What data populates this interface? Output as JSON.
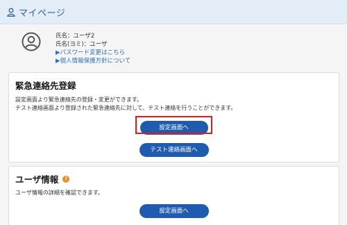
{
  "header": {
    "title": "マイページ",
    "icon": "user-icon"
  },
  "profile": {
    "avatar_icon": "user-circle-icon",
    "name": "氏名：ユーザ2",
    "name_kana": "氏名(ヨミ)：ユーザ",
    "password_link": "▶パスワード変更はこちら",
    "privacy_link": "▶個人情報保護方針について"
  },
  "emergency": {
    "title": "緊急連絡先登録",
    "desc1": "設定画面より緊急連絡先の登録・変更ができます。",
    "desc2": "テスト連絡画面より登録された緊急連絡先に対して、テスト連絡を行うことができます。",
    "settings_button": "設定画面へ",
    "test_button": "テスト連絡画面へ"
  },
  "user_info": {
    "title": "ユーザ情報",
    "badge": "!",
    "desc": "ユーザ情報の詳細を確認できます。",
    "settings_button": "設定画面へ"
  },
  "colors": {
    "header_bg": "#e3edf8",
    "button": "#1f5cb0",
    "link": "#2c6fc0",
    "badge": "#f08a24",
    "highlight": "#e21a1a"
  }
}
